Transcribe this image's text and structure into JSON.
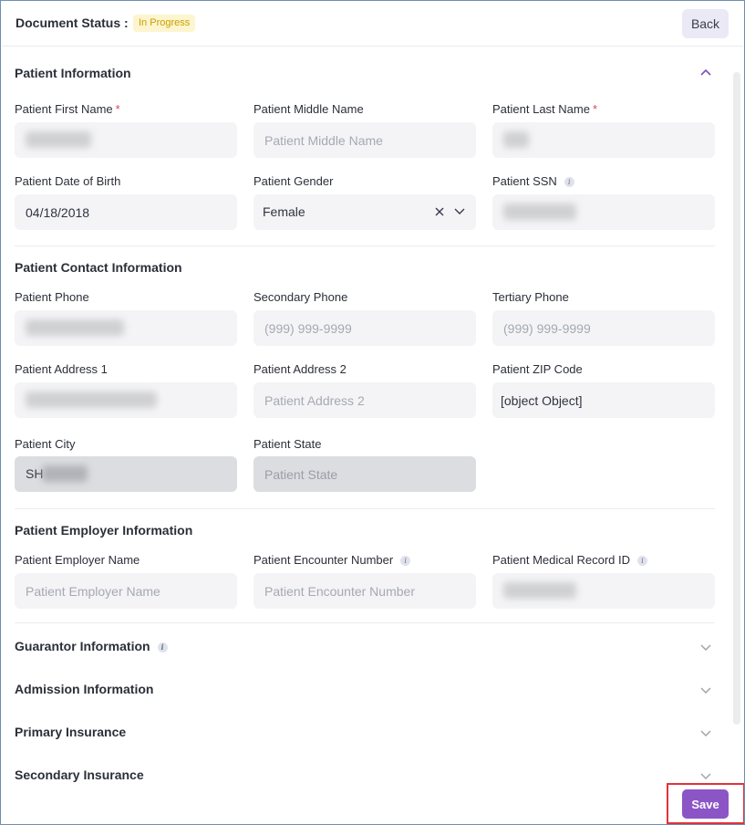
{
  "header": {
    "status_label": "Document Status :",
    "status_badge": "In Progress",
    "back_label": "Back"
  },
  "patient_info": {
    "title": "Patient Information",
    "first_name": {
      "label": "Patient First Name",
      "required_mark": "*",
      "value": "[blurred]"
    },
    "middle_name": {
      "label": "Patient Middle Name",
      "placeholder": "Patient Middle Name"
    },
    "last_name": {
      "label": "Patient Last Name",
      "required_mark": "*",
      "value": "[blurred]"
    },
    "dob": {
      "label": "Patient Date of Birth",
      "value": "04/18/2018"
    },
    "gender": {
      "label": "Patient Gender",
      "value": "Female"
    },
    "ssn": {
      "label": "Patient SSN",
      "value": "[blurred]"
    }
  },
  "contact_info": {
    "title": "Patient Contact Information",
    "phone": {
      "label": "Patient Phone",
      "value": "[blurred]"
    },
    "secondary_phone": {
      "label": "Secondary Phone",
      "placeholder": "(999) 999-9999"
    },
    "tertiary_phone": {
      "label": "Tertiary Phone",
      "placeholder": "(999) 999-9999"
    },
    "address1": {
      "label": "Patient Address 1",
      "value": "[blurred]"
    },
    "address2": {
      "label": "Patient Address 2",
      "placeholder": "Patient Address 2"
    },
    "zip": {
      "label": "Patient ZIP Code",
      "value": "[object Object]"
    },
    "city": {
      "label": "Patient City",
      "value": "SH[blurred]"
    },
    "state": {
      "label": "Patient State",
      "placeholder": "Patient State"
    }
  },
  "employer_info": {
    "title": "Patient Employer Information",
    "employer_name": {
      "label": "Patient Employer Name",
      "placeholder": "Patient Employer Name"
    },
    "encounter_number": {
      "label": "Patient Encounter Number",
      "placeholder": "Patient Encounter Number"
    },
    "medical_record_id": {
      "label": "Patient Medical Record ID",
      "value": "[blurred]"
    }
  },
  "collapsed_sections": [
    {
      "title": "Guarantor Information",
      "has_info": true
    },
    {
      "title": "Admission Information",
      "has_info": false
    },
    {
      "title": "Primary Insurance",
      "has_info": false
    },
    {
      "title": "Secondary Insurance",
      "has_info": false
    }
  ],
  "footer": {
    "save_label": "Save"
  },
  "colors": {
    "accent": "#8c55c6",
    "badge_bg": "#fdf5cf",
    "badge_text": "#c9a000",
    "required": "#e0445a",
    "highlight_box": "#e2323a"
  },
  "icons": {
    "collapse": "chevron-up-icon",
    "expand": "chevron-down-icon",
    "clear": "close-icon",
    "info": "info-icon"
  }
}
